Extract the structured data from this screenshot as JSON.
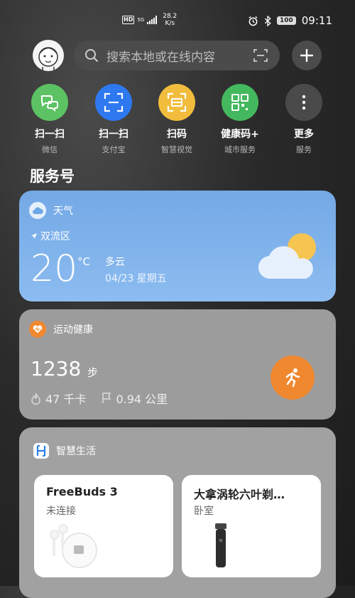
{
  "status_bar": {
    "hd": "HD",
    "network": "5G",
    "net_speed_value": "28.2",
    "net_speed_unit": "K/s",
    "battery": "100",
    "time": "09:11"
  },
  "search": {
    "placeholder": "搜索本地或在线内容"
  },
  "quick_actions": [
    {
      "label": "扫一扫",
      "sub": "微信",
      "color": "#5dc264",
      "icon": "wechat-scan-icon"
    },
    {
      "label": "扫一扫",
      "sub": "支付宝",
      "color": "#2e78f0",
      "icon": "alipay-scan-icon"
    },
    {
      "label": "扫码",
      "sub": "智慧视觉",
      "color": "#f2bd3c",
      "icon": "scan-code-icon"
    },
    {
      "label": "健康码+",
      "sub": "城市服务",
      "color": "#44b85e",
      "icon": "health-code-icon"
    },
    {
      "label": "更多",
      "sub": "服务",
      "color": "#4a4a4a",
      "icon": "more-icon"
    }
  ],
  "section_title": "服务号",
  "weather": {
    "title": "天气",
    "location": "双流区",
    "temp": "20",
    "unit": "°C",
    "condition": "多云",
    "date": "04/23 星期五"
  },
  "health": {
    "title": "运动健康",
    "steps": "1238",
    "steps_unit": "步",
    "calories": "47 千卡",
    "distance": "0.94 公里"
  },
  "smart_life": {
    "title": "智慧生活",
    "devices": [
      {
        "name": "FreeBuds 3",
        "status": "未连接"
      },
      {
        "name": "大拿涡轮六叶剃…",
        "status": "卧室"
      }
    ]
  }
}
